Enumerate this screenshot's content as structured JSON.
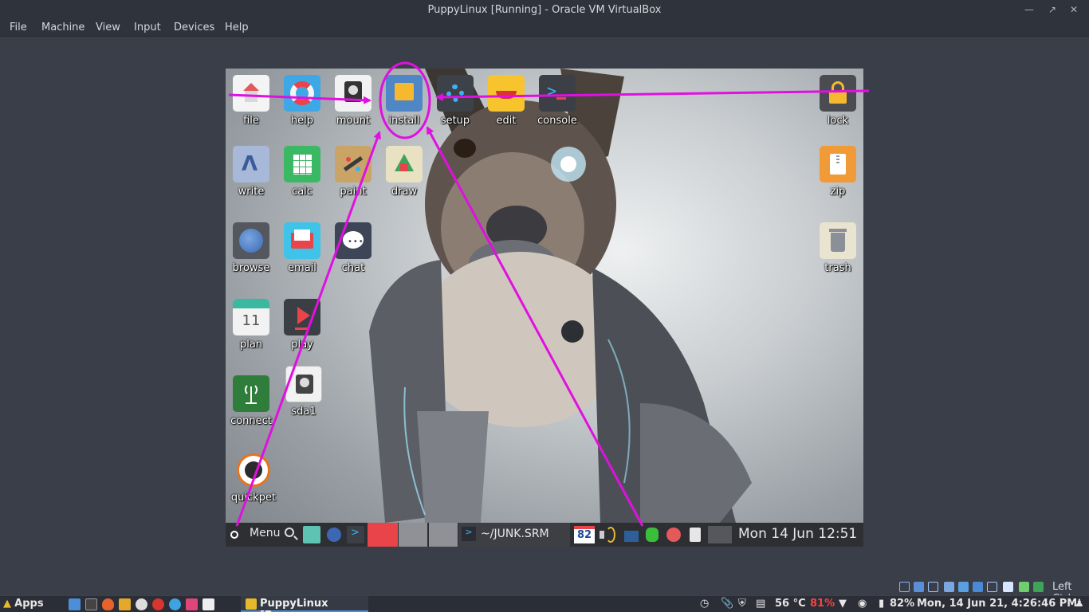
{
  "window": {
    "title": "PuppyLinux [Running] - Oracle VM VirtualBox",
    "minimize_icon": "minimize-icon",
    "restore_icon": "restore-icon",
    "close_icon": "close-icon"
  },
  "menu": [
    "File",
    "Machine",
    "View",
    "Input",
    "Devices",
    "Help"
  ],
  "vm": {
    "desktop_icons": {
      "file": "file",
      "help": "help",
      "mount": "mount",
      "install": "install",
      "setup": "setup",
      "edit": "edit",
      "console": "console",
      "lock": "lock",
      "write": "write",
      "calc": "calc",
      "paint": "paint",
      "draw": "draw",
      "zip": "zip",
      "browse": "browse",
      "email": "email",
      "chat": "chat",
      "trash": "trash",
      "plan": "plan",
      "plan_day": "11",
      "play": "play",
      "connect": "connect",
      "sda1": "sda1",
      "quickpet": "quickpet"
    },
    "taskbar": {
      "menu_label": "Menu",
      "window_task": "~/JUNK.SRM",
      "badge": "82",
      "clock": "Mon 14 Jun 12:51"
    }
  },
  "host_status": {
    "key_label": "Left Ctrl"
  },
  "panel": {
    "apps_label": "Apps",
    "task_label": "PuppyLinux [Run...",
    "temperature": "56 °C",
    "cpu": "81%",
    "battery": "82%",
    "datetime": "Mon, 14 Jun 21, 4:26:46 PM"
  },
  "colors": {
    "annotation": "#e010e0",
    "accent_red": "#e8444a",
    "cpu_red": "#ff4040"
  }
}
